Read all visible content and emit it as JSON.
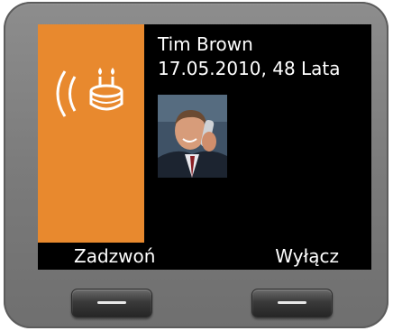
{
  "call": {
    "caller_name": "Tim Brown",
    "birthday_line": "17.05.2010, 48 Lata"
  },
  "softkeys": {
    "left_label": "Zadzwoń",
    "right_label": "Wyłącz"
  },
  "icons": {
    "status": "birthday-ringing-icon",
    "photo": "caller-photo"
  },
  "colors": {
    "accent": "#e8892e",
    "screen": "#000000",
    "text": "#ffffff",
    "bezel": "#7a7a7a"
  }
}
